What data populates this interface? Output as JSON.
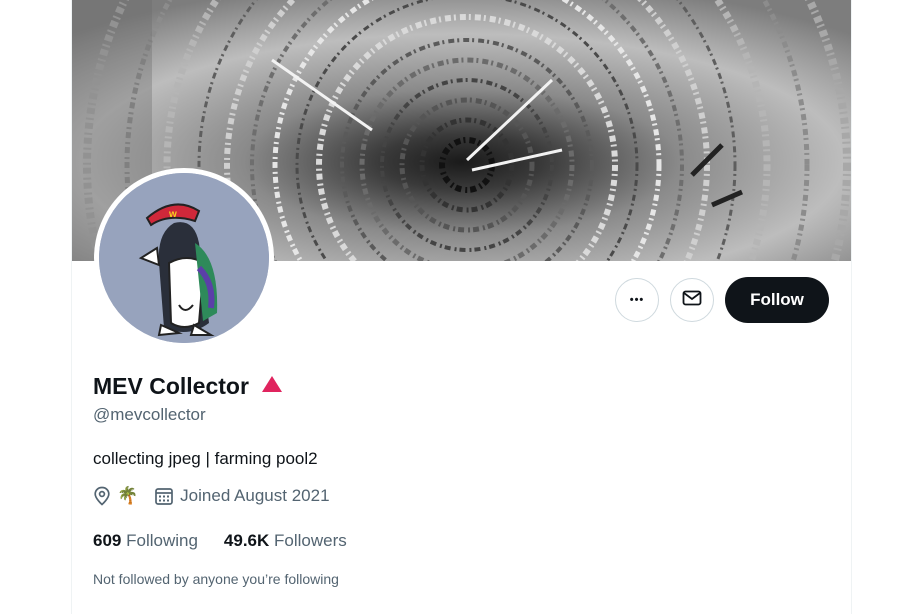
{
  "profile": {
    "display_name": "MEV Collector",
    "handle": "@mevcollector",
    "bio": "collecting jpeg | farming pool2",
    "location": "🌴",
    "joined": "Joined August 2021",
    "following_count": "609",
    "following_label": "Following",
    "followers_count": "49.6K",
    "followers_label": "Followers",
    "follow_context": "Not followed by anyone you’re following"
  },
  "actions": {
    "more_label": "•••",
    "follow_label": "Follow"
  },
  "colors": {
    "accent_triangle": "#e0245e",
    "follow_bg": "#0f1419",
    "secondary_text": "#536471"
  }
}
